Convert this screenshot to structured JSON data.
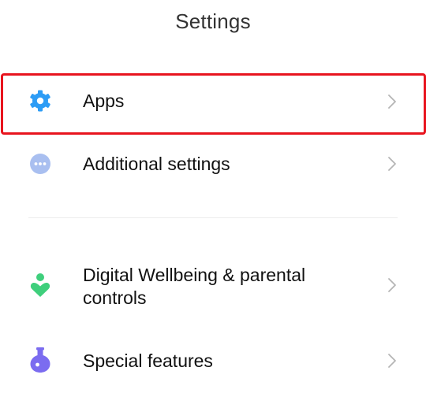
{
  "header": {
    "title": "Settings"
  },
  "items": [
    {
      "label": "Apps",
      "icon": "gear-icon",
      "icon_color": "#2d9cf5"
    },
    {
      "label": "Additional settings",
      "icon": "more-dots-icon",
      "icon_color": "#a9bff0"
    },
    {
      "label": "Digital Wellbeing & parental controls",
      "label_line1": "Digital Wellbeing & parental",
      "label_line2": "controls",
      "icon": "wellbeing-icon",
      "icon_color": "#3fcf7c"
    },
    {
      "label": "Special features",
      "icon": "flask-icon",
      "icon_color": "#7b6cf0"
    }
  ],
  "highlight_color": "#e8141e"
}
